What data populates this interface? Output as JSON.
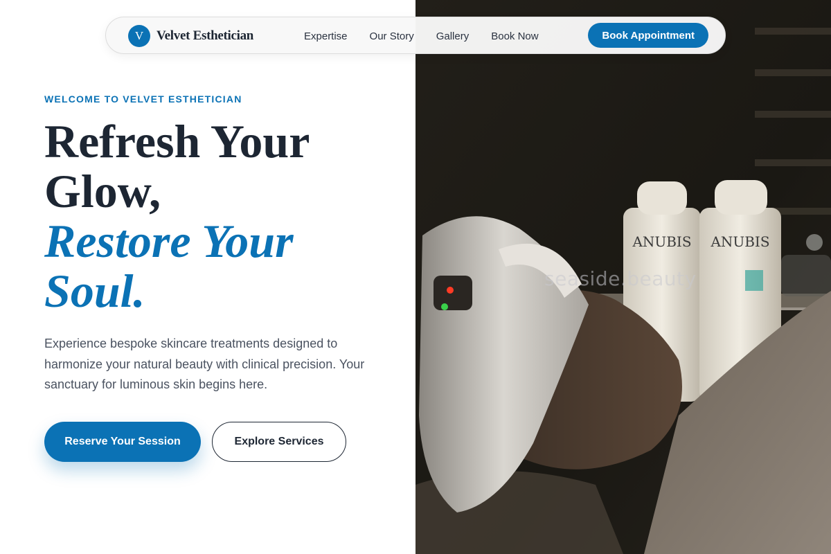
{
  "brand": {
    "initial": "V",
    "name": "Velvet Esthetician"
  },
  "nav": {
    "links": [
      "Expertise",
      "Our Story",
      "Gallery",
      "Book Now"
    ],
    "cta": "Book Appointment"
  },
  "hero": {
    "eyebrow": "WELCOME TO VELVET ESTHETICIAN",
    "headline_line1": "Refresh Your",
    "headline_line2": "Glow,",
    "headline_accent1": "Restore Your",
    "headline_accent2": "Soul.",
    "lede": "Experience bespoke skincare treatments designed to harmonize your natural beauty with clinical precision. Your sanctuary for luminous skin begins here.",
    "primary_cta": "Reserve Your Session",
    "secondary_cta": "Explore Services"
  },
  "image": {
    "watermark": "seaside.beauty",
    "bottle_brand_left": "ANUBIS",
    "bottle_brand_right": "ANUBIS"
  },
  "colors": {
    "accent": "#0b72b5",
    "heading": "#1d2633",
    "body_text": "#4a5260"
  }
}
